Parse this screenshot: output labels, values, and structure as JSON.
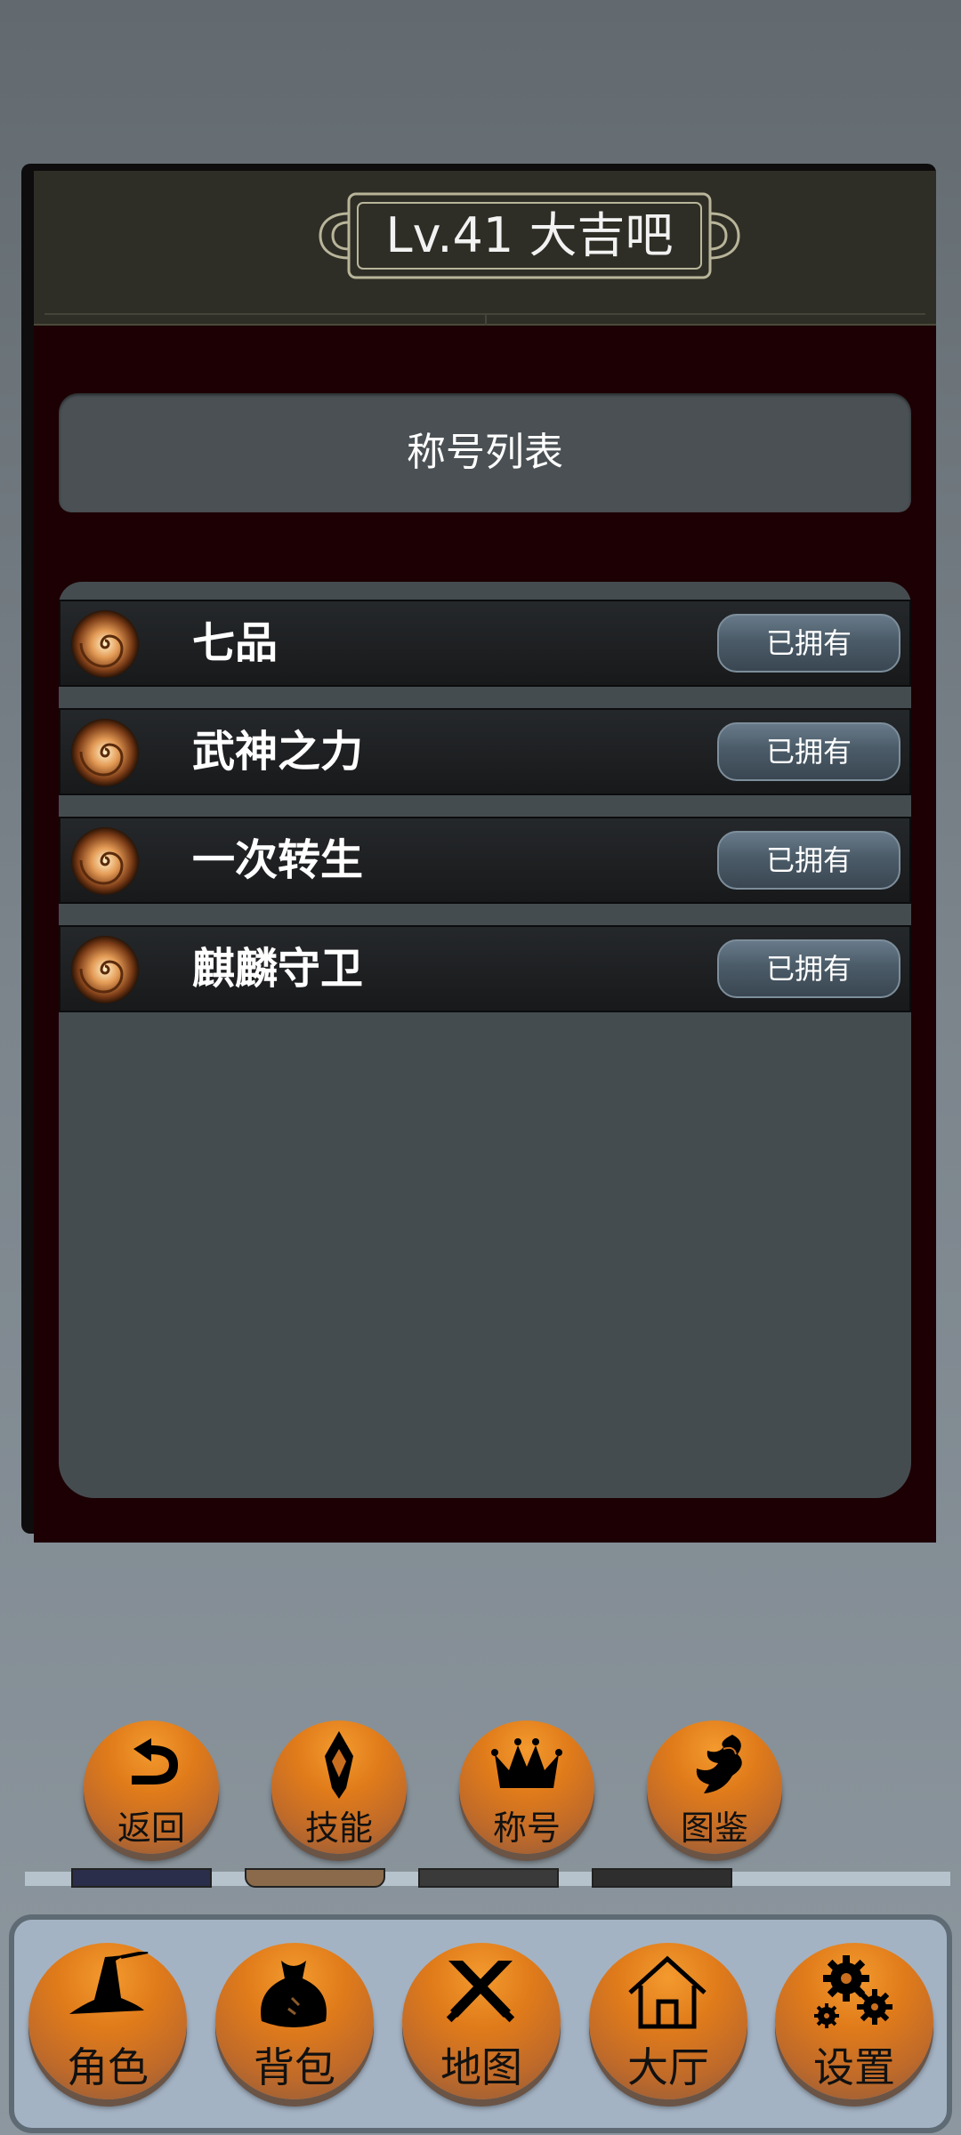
{
  "header": {
    "title": "Lv.41 大吉吧"
  },
  "section": {
    "title": "称号列表"
  },
  "titles_list": [
    {
      "name": "七品",
      "status": "已拥有",
      "icon": "swirl-icon"
    },
    {
      "name": "武神之力",
      "status": "已拥有",
      "icon": "swirl-icon"
    },
    {
      "name": "一次转生",
      "status": "已拥有",
      "icon": "swirl-icon"
    },
    {
      "name": "麒麟守卫",
      "status": "已拥有",
      "icon": "swirl-icon"
    }
  ],
  "actions": [
    {
      "label": "返回",
      "icon": "return-arrow-icon"
    },
    {
      "label": "技能",
      "icon": "skill-emblem-icon"
    },
    {
      "label": "称号",
      "icon": "crown-icon"
    },
    {
      "label": "图鉴",
      "icon": "dragon-icon"
    }
  ],
  "nav": [
    {
      "label": "角色",
      "icon": "wizard-hat-icon"
    },
    {
      "label": "背包",
      "icon": "bag-icon"
    },
    {
      "label": "地图",
      "icon": "crossed-swords-icon"
    },
    {
      "label": "大厅",
      "icon": "house-icon"
    },
    {
      "label": "设置",
      "icon": "gears-icon"
    }
  ],
  "colors": {
    "panel": "#1c0003",
    "list_bg": "#454c50",
    "accent_orange": "#e07b1a",
    "nav_bg": "#a4b3c4"
  }
}
